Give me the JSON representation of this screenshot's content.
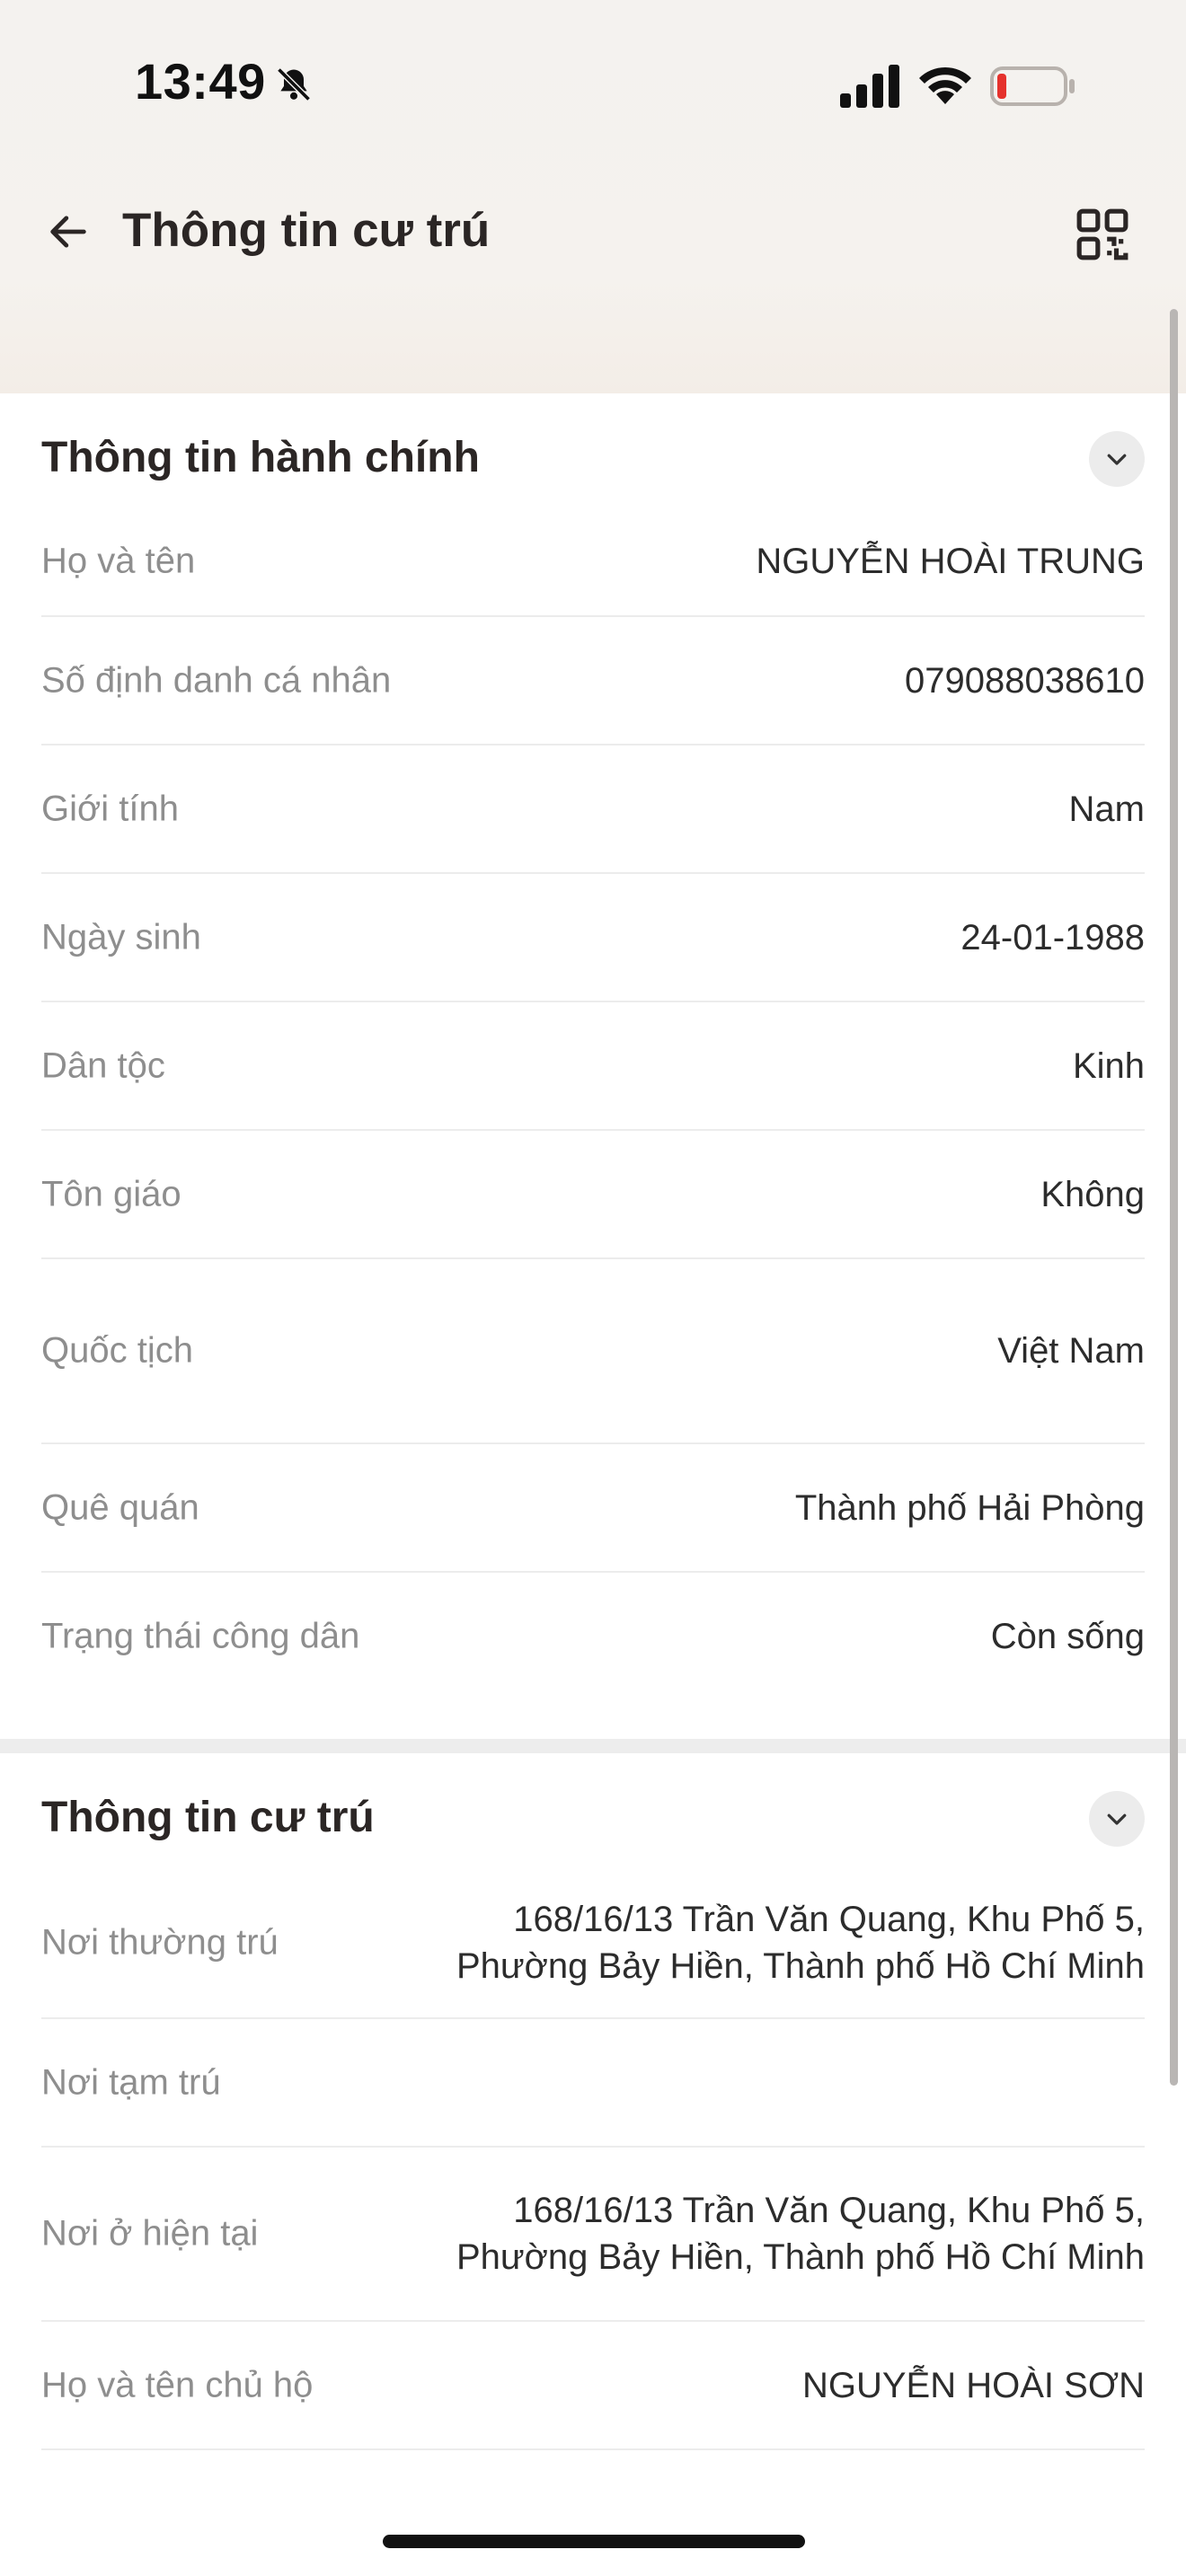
{
  "status_bar": {
    "time": "13:49"
  },
  "header": {
    "title": "Thông tin cư trú"
  },
  "administrative": {
    "title": "Thông tin hành chính",
    "rows": [
      {
        "label": "Họ và tên",
        "value": "NGUYỄN HOÀI TRUNG"
      },
      {
        "label": "Số định danh cá nhân",
        "value": "079088038610"
      },
      {
        "label": "Giới tính",
        "value": "Nam"
      },
      {
        "label": "Ngày sinh",
        "value": "24-01-1988"
      },
      {
        "label": "Dân tộc",
        "value": "Kinh"
      },
      {
        "label": "Tôn giáo",
        "value": "Không"
      },
      {
        "label": "Quốc tịch",
        "value": "Việt Nam"
      },
      {
        "label": "Quê quán",
        "value": "Thành phố Hải Phòng"
      },
      {
        "label": "Trạng thái công dân",
        "value": "Còn sống"
      }
    ]
  },
  "residence": {
    "title": "Thông tin cư trú",
    "rows": [
      {
        "label": "Nơi thường trú",
        "value": "168/16/13 Trần Văn Quang, Khu Phố 5,\nPhường Bảy Hiền, Thành phố Hồ Chí Minh"
      },
      {
        "label": "Nơi tạm trú",
        "value": ""
      },
      {
        "label": "Nơi ở hiện tại",
        "value": "168/16/13 Trần Văn Quang, Khu Phố 5,\nPhường Bảy Hiền, Thành phố Hồ Chí Minh"
      },
      {
        "label": "Họ và tên chủ hộ",
        "value": "NGUYỄN HOÀI SƠN"
      }
    ]
  },
  "colors": {
    "battery_low": "#e5322d",
    "background_top": "#f4f2ef"
  }
}
